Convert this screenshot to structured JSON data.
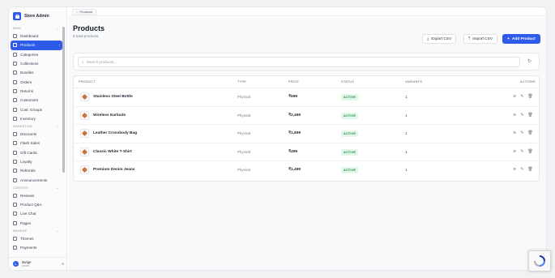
{
  "brand": {
    "name": "Store Admin"
  },
  "breadcrumb": {
    "current": "Products"
  },
  "sidebar": {
    "sections": [
      {
        "label": "MAIN",
        "items": [
          {
            "label": "Dashboard"
          },
          {
            "label": "Products",
            "active": true
          },
          {
            "label": "Categories"
          },
          {
            "label": "Collections"
          },
          {
            "label": "Bundles"
          },
          {
            "label": "Orders"
          },
          {
            "label": "Returns"
          },
          {
            "label": "Customers"
          },
          {
            "label": "Cust. Groups"
          },
          {
            "label": "Inventory"
          }
        ]
      },
      {
        "label": "MARKETING",
        "items": [
          {
            "label": "Discounts"
          },
          {
            "label": "Flash Sales"
          },
          {
            "label": "Gift Cards"
          },
          {
            "label": "Loyalty"
          },
          {
            "label": "Referrals"
          },
          {
            "label": "Announcements"
          }
        ]
      },
      {
        "label": "CONTENT",
        "items": [
          {
            "label": "Reviews"
          },
          {
            "label": "Product Q&A"
          },
          {
            "label": "Live Chat"
          },
          {
            "label": "Pages"
          }
        ]
      },
      {
        "label": "MANAGE",
        "items": [
          {
            "label": "Themes"
          },
          {
            "label": "Payments"
          }
        ]
      }
    ],
    "user": {
      "initial": "L",
      "name": "lavige",
      "role": "admin"
    }
  },
  "page": {
    "title": "Products",
    "subtitle": "5 total products",
    "export_label": "Export CSV",
    "import_label": "Import CSV",
    "add_label": "Add Product"
  },
  "search": {
    "placeholder": "Search products..."
  },
  "table": {
    "headers": {
      "product": "PRODUCT",
      "type": "TYPE",
      "price": "PRICE",
      "status": "STATUS",
      "variants": "VARIANTS",
      "actions": "ACTIONS"
    },
    "rows": [
      {
        "name": "Stainless Steel Bottle",
        "type": "Physical",
        "price": "₹599",
        "status": "ACTIVE",
        "variants": "1"
      },
      {
        "name": "Wireless Earbuds",
        "type": "Physical",
        "price": "₹2,499",
        "status": "ACTIVE",
        "variants": "1"
      },
      {
        "name": "Leather Crossbody Bag",
        "type": "Physical",
        "price": "₹1,899",
        "status": "ACTIVE",
        "variants": "1"
      },
      {
        "name": "Classic White T-Shirt",
        "type": "Physical",
        "price": "₹499",
        "status": "ACTIVE",
        "variants": "1"
      },
      {
        "name": "Premium Denim Jeans",
        "type": "Physical",
        "price": "₹1,499",
        "status": "ACTIVE",
        "variants": "1"
      }
    ]
  },
  "colors": {
    "accent": "#2f5bea",
    "active_badge_bg": "#e2f6e9",
    "active_badge_text": "#1f8a4c"
  }
}
